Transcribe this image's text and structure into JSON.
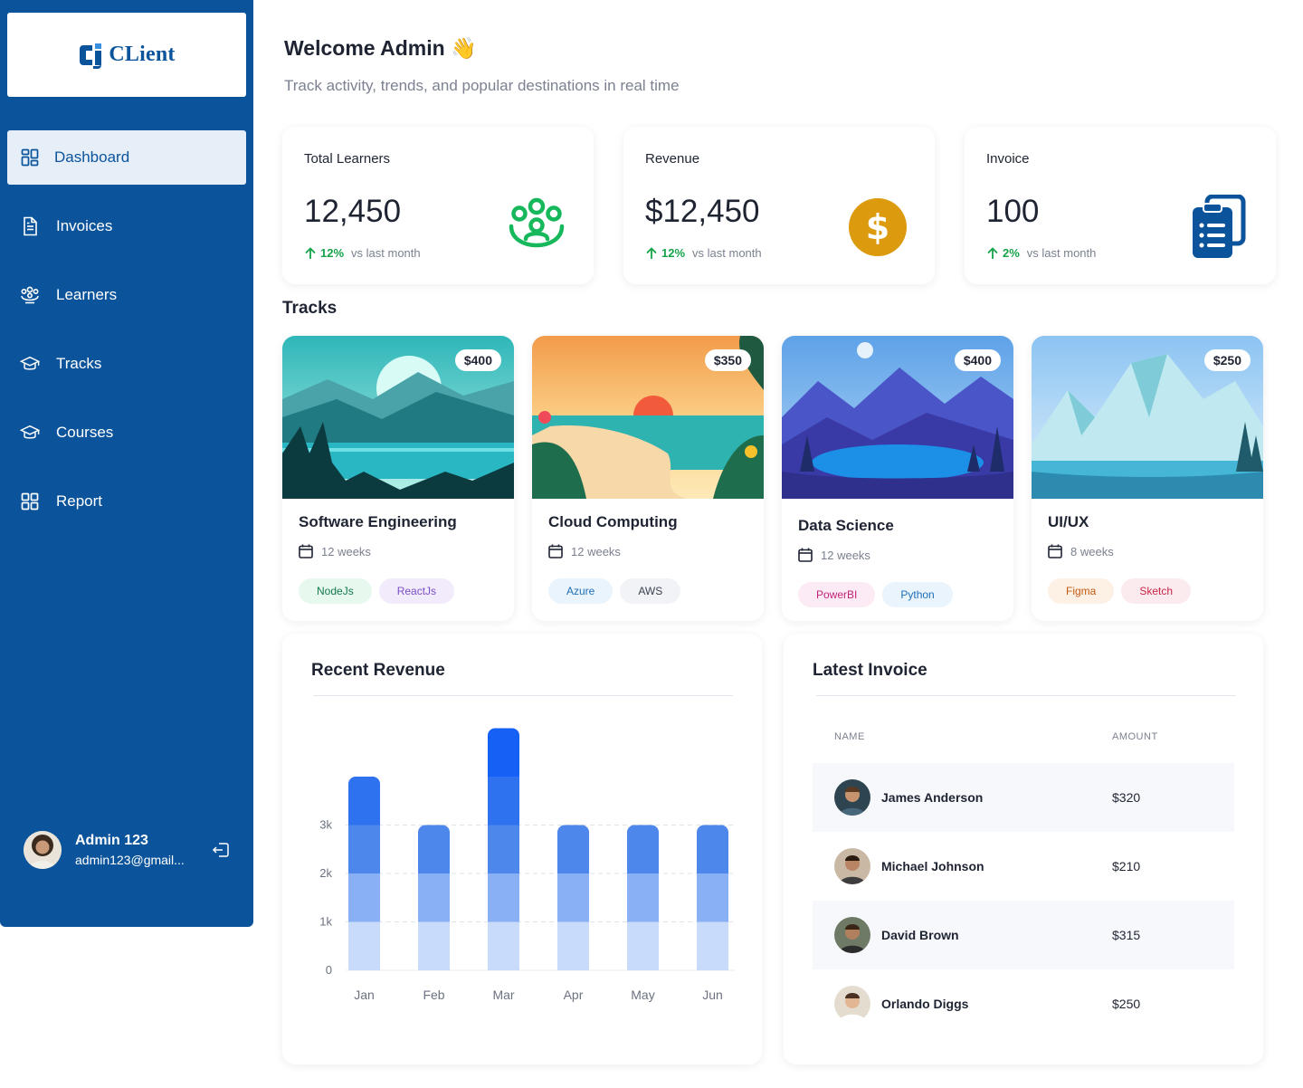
{
  "brand": {
    "name": "CLient"
  },
  "nav": [
    {
      "label": "Dashboard",
      "icon": "dashboard-icon",
      "active": true
    },
    {
      "label": "Invoices",
      "icon": "invoice-icon"
    },
    {
      "label": "Learners",
      "icon": "learners-icon"
    },
    {
      "label": "Tracks",
      "icon": "graduation-cap-icon"
    },
    {
      "label": "Courses",
      "icon": "graduation-cap-icon"
    },
    {
      "label": "Report",
      "icon": "report-icon"
    }
  ],
  "user": {
    "name": "Admin 123",
    "email": "admin123@gmail..."
  },
  "header": {
    "welcome": "Welcome Admin",
    "wave": "👋",
    "subtitle": "Track activity, trends, and popular destinations in real time"
  },
  "stats": [
    {
      "label": "Total Learners",
      "value": "12,450",
      "pct": "12%",
      "compare": "vs last month",
      "icon": "learners-group-icon"
    },
    {
      "label": "Revenue",
      "value": "$12,450",
      "pct": "12%",
      "compare": "vs last month",
      "icon": "dollar-coin-icon"
    },
    {
      "label": "Invoice",
      "value": "100",
      "pct": "2%",
      "compare": "vs last month",
      "icon": "clipboard-list-icon"
    }
  ],
  "tracks_title": "Tracks",
  "tracks": [
    {
      "title": "Software Engineering",
      "price": "$400",
      "duration": "12 weeks",
      "tags": [
        "NodeJs",
        "ReactJs"
      ]
    },
    {
      "title": "Cloud Computing",
      "price": "$350",
      "duration": "12 weeks",
      "tags": [
        "Azure",
        "AWS"
      ]
    },
    {
      "title": "Data Science",
      "price": "$400",
      "duration": "12 weeks",
      "tags": [
        "PowerBI",
        "Python"
      ]
    },
    {
      "title": "UI/UX",
      "price": "$250",
      "duration": "8 weeks",
      "tags": [
        "Figma",
        "Sketch"
      ]
    }
  ],
  "colors": {
    "sidebar": "#0b549b",
    "accent": "#1a66f2",
    "positive": "#16a34a",
    "coin": "#dc9a0e"
  },
  "revenue": {
    "title": "Recent Revenue"
  },
  "chart_data": {
    "type": "bar",
    "categories": [
      "Jan",
      "Feb",
      "Mar",
      "Apr",
      "May",
      "Jun"
    ],
    "values": [
      4000,
      3000,
      5000,
      3000,
      3000,
      3000
    ],
    "yticks": [
      "0",
      "1k",
      "2k",
      "3k"
    ],
    "ylim": [
      0,
      5000
    ],
    "xlabel": "",
    "ylabel": "",
    "grid": true
  },
  "invoice": {
    "title": "Latest Invoice",
    "col_name": "NAME",
    "col_amount": "AMOUNT",
    "rows": [
      {
        "name": "James Anderson",
        "amount": "$320"
      },
      {
        "name": "Michael Johnson",
        "amount": "$210"
      },
      {
        "name": "David Brown",
        "amount": "$315"
      },
      {
        "name": "Orlando Diggs",
        "amount": "$250"
      }
    ]
  }
}
